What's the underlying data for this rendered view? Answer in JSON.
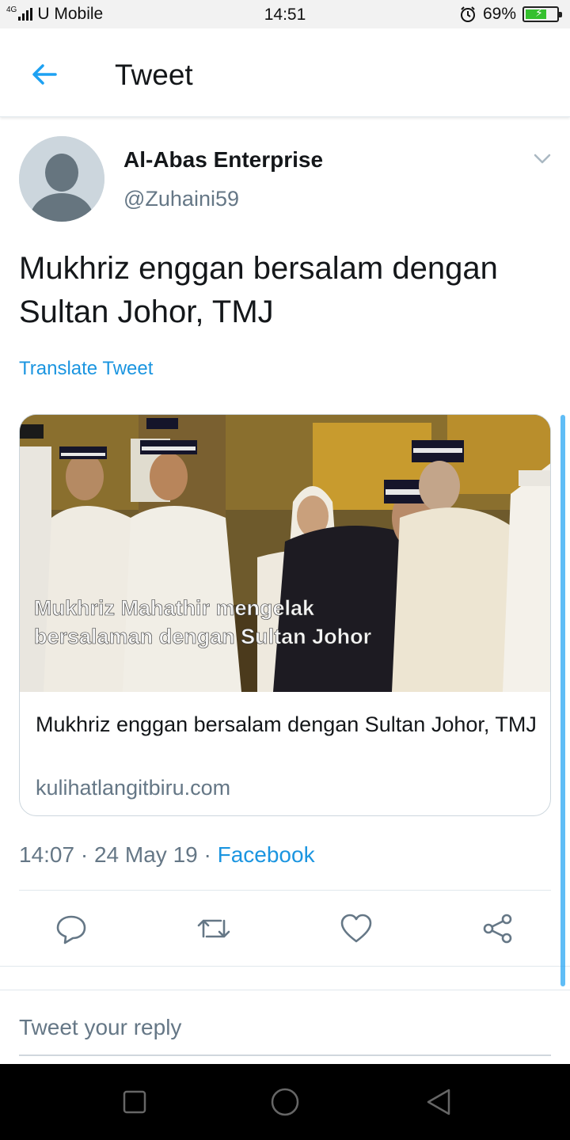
{
  "status_bar": {
    "network": "4G",
    "carrier": "U Mobile",
    "time": "14:51",
    "battery": "69%",
    "battery_level": 0.69
  },
  "header": {
    "title": "Tweet",
    "back_icon": "arrow-left-icon"
  },
  "tweet": {
    "author_name": "Al-Abas Enterprise",
    "author_handle": "@Zuhaini59",
    "text": "Mukhriz enggan bersalam dengan Sultan Johor, TMJ",
    "translate_label": "Translate Tweet",
    "card": {
      "image_caption_line1": "Mukhriz Mahathir mengelak",
      "image_caption_line2": "bersalaman dengan Sultan Johor",
      "title": "Mukhriz enggan bersalam dengan Sultan Johor, TMJ",
      "domain": "kulihatlangitbiru.com"
    },
    "time": "14:07",
    "date": "24 May 19",
    "source": "Facebook",
    "separator": "·"
  },
  "actions": {
    "reply_icon": "reply-icon",
    "retweet_icon": "retweet-icon",
    "like_icon": "heart-icon",
    "share_icon": "share-icon"
  },
  "reply_box": {
    "placeholder": "Tweet your reply"
  },
  "colors": {
    "accent": "#1b95e0",
    "secondary_text": "#657786",
    "border": "#e1e8ed"
  }
}
